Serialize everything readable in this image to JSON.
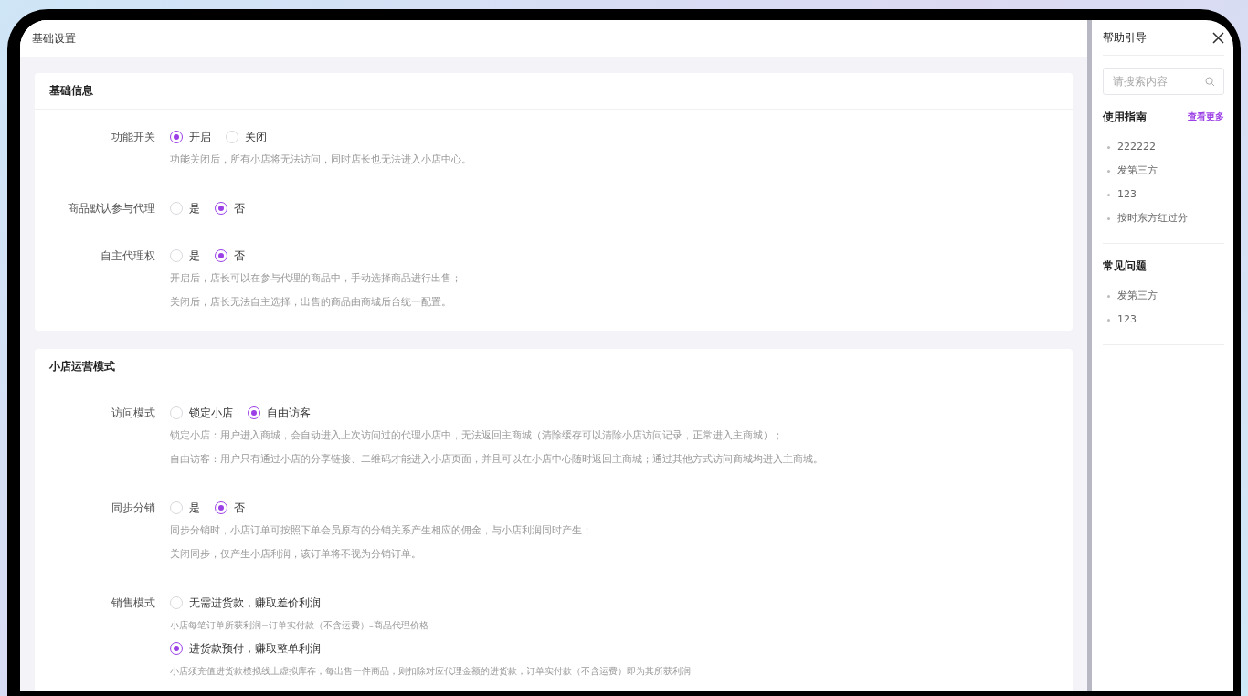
{
  "page_title": "基础设置",
  "sections": [
    {
      "title": "基础信息",
      "fields": [
        {
          "label": "功能开关",
          "kind": "inline",
          "options": [
            {
              "label": "开启",
              "selected": true
            },
            {
              "label": "关闭",
              "selected": false
            }
          ],
          "notes": [
            "功能关闭后，所有小店将无法访问，同时店长也无法进入小店中心。"
          ]
        },
        {
          "label": "商品默认参与代理",
          "kind": "inline",
          "options": [
            {
              "label": "是",
              "selected": false
            },
            {
              "label": "否",
              "selected": true
            }
          ]
        },
        {
          "label": "自主代理权",
          "kind": "inline",
          "options": [
            {
              "label": "是",
              "selected": false
            },
            {
              "label": "否",
              "selected": true
            }
          ],
          "notes": [
            "开启后，店长可以在参与代理的商品中，手动选择商品进行出售；",
            "关闭后，店长无法自主选择，出售的商品由商城后台统一配置。"
          ]
        }
      ]
    },
    {
      "title": "小店运营模式",
      "fields": [
        {
          "label": "访问模式",
          "kind": "inline",
          "options": [
            {
              "label": "锁定小店",
              "selected": false
            },
            {
              "label": "自由访客",
              "selected": true
            }
          ],
          "notes": [
            "锁定小店：用户进入商城，会自动进入上次访问过的代理小店中，无法返回主商城（清除缓存可以清除小店访问记录，正常进入主商城）；",
            "自由访客：用户只有通过小店的分享链接、二维码才能进入小店页面，并且可以在小店中心随时返回主商城；通过其他方式访问商城均进入主商城。"
          ]
        },
        {
          "label": "同步分销",
          "kind": "inline",
          "options": [
            {
              "label": "是",
              "selected": false
            },
            {
              "label": "否",
              "selected": true
            }
          ],
          "notes": [
            "同步分销时，小店订单可按照下单会员原有的分销关系产生相应的佣金，与小店利润同时产生；",
            "关闭同步，仅产生小店利润，该订单将不视为分销订单。"
          ]
        },
        {
          "label": "销售模式",
          "kind": "stacked",
          "options": [
            {
              "label": "无需进货款，赚取差价利润",
              "selected": false,
              "note": "小店每笔订单所获利润=订单实付款（不含运费）–商品代理价格"
            },
            {
              "label": "进货款预付，赚取整单利润",
              "selected": true,
              "note": "小店须充值进货款模拟线上虚拟库存，每出售一件商品，则扣除对应代理金额的进货款，订单实付款（不含运费）即为其所获利润"
            }
          ]
        }
      ]
    }
  ],
  "help": {
    "title": "帮助引导",
    "search": {
      "placeholder": "请搜索内容"
    },
    "groups": [
      {
        "title": "使用指南",
        "link": "查看更多",
        "items": [
          "222222",
          "发第三方",
          "123",
          "按时东方红过分"
        ]
      },
      {
        "title": "常见问题",
        "items": [
          "发第三方",
          "123"
        ]
      }
    ]
  }
}
